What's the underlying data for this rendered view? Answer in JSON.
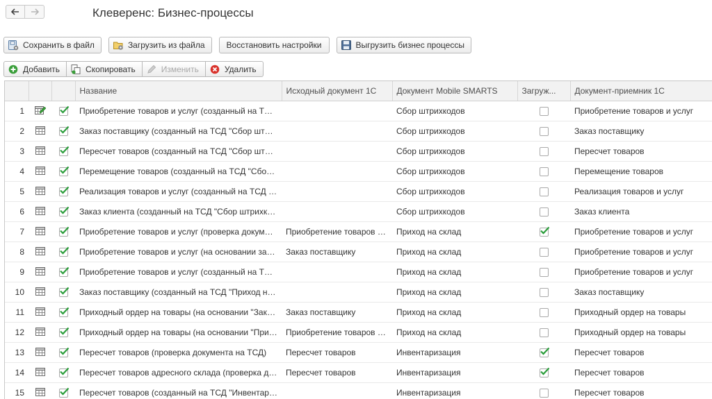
{
  "window": {
    "title": "Клеверенс: Бизнес-процессы"
  },
  "nav": {
    "back_icon": "arrow-left-icon",
    "forward_icon": "arrow-right-icon"
  },
  "toolbar1": {
    "save": "Сохранить в файл",
    "load": "Загрузить из файла",
    "restore": "Восстановить настройки",
    "export": "Выгрузить бизнес процессы"
  },
  "toolbar2": {
    "add": "Добавить",
    "copy": "Скопировать",
    "edit": "Изменить",
    "delete": "Удалить"
  },
  "colors": {
    "check_green": "#2a9d3a",
    "delete_red": "#d9322b",
    "add_green": "#3a9e3a"
  },
  "table": {
    "columns": [
      "",
      "",
      "",
      "Название",
      "Исходный документ 1С",
      "Документ Mobile SMARTS",
      "Загруж...",
      "Документ-приемник 1С"
    ],
    "rows": [
      {
        "n": "1",
        "icon": "edit-table-icon",
        "enabled": true,
        "name": "Приобретение товаров и услуг (созданный на ТСД \"Сбор штрихкодов\")",
        "src": "",
        "mobile": "Сбор штрихкодов",
        "loaded": false,
        "dest": "Приобретение товаров и услуг"
      },
      {
        "n": "2",
        "icon": "table-icon",
        "enabled": true,
        "name": "Заказ поставщику (созданный на ТСД \"Сбор штрихкодов\")",
        "src": "",
        "mobile": "Сбор штрихкодов",
        "loaded": false,
        "dest": "Заказ поставщику"
      },
      {
        "n": "3",
        "icon": "table-icon",
        "enabled": true,
        "name": "Пересчет товаров (созданный на ТСД \"Сбор штрихкодов\")",
        "src": "",
        "mobile": "Сбор штрихкодов",
        "loaded": false,
        "dest": "Пересчет товаров"
      },
      {
        "n": "4",
        "icon": "table-icon",
        "enabled": true,
        "name": "Перемещение товаров (созданный на ТСД \"Сбор штрихкодов\")",
        "src": "",
        "mobile": "Сбор штрихкодов",
        "loaded": false,
        "dest": "Перемещение товаров"
      },
      {
        "n": "5",
        "icon": "table-icon",
        "enabled": true,
        "name": "Реализация товаров и услуг (созданный на ТСД \"Сбор штрихкодов\")",
        "src": "",
        "mobile": "Сбор штрихкодов",
        "loaded": false,
        "dest": "Реализация товаров и услуг"
      },
      {
        "n": "6",
        "icon": "table-icon",
        "enabled": true,
        "name": "Заказ клиента (созданный на ТСД \"Сбор штрихкодов\")",
        "src": "",
        "mobile": "Сбор штрихкодов",
        "loaded": false,
        "dest": "Заказ клиента"
      },
      {
        "n": "7",
        "icon": "table-icon",
        "enabled": true,
        "name": "Приобретение товаров и услуг (проверка документа)",
        "src": "Приобретение товаров и услуг",
        "mobile": "Приход на склад",
        "loaded": true,
        "dest": "Приобретение товаров и услуг"
      },
      {
        "n": "8",
        "icon": "table-icon",
        "enabled": true,
        "name": "Приобретение товаров и услуг (на основании заказа)",
        "src": "Заказ поставщику",
        "mobile": "Приход на склад",
        "loaded": false,
        "dest": "Приобретение товаров и услуг"
      },
      {
        "n": "9",
        "icon": "table-icon",
        "enabled": true,
        "name": "Приобретение товаров и услуг (созданный на ТСД \"Приход на склад\")",
        "src": "",
        "mobile": "Приход на склад",
        "loaded": false,
        "dest": "Приобретение товаров и услуг"
      },
      {
        "n": "10",
        "icon": "table-icon",
        "enabled": true,
        "name": "Заказ поставщику (созданный на ТСД \"Приход на склад\")",
        "src": "",
        "mobile": "Приход на склад",
        "loaded": false,
        "dest": "Заказ поставщику"
      },
      {
        "n": "11",
        "icon": "table-icon",
        "enabled": true,
        "name": "Приходный ордер на товары (на основании \"Заказ поставщику\")",
        "src": "Заказ поставщику",
        "mobile": "Приход на склад",
        "loaded": false,
        "dest": "Приходный ордер на товары"
      },
      {
        "n": "12",
        "icon": "table-icon",
        "enabled": true,
        "name": "Приходный ордер на товары (на основании \"Приобретение товаров\")",
        "src": "Приобретение товаров и услуг",
        "mobile": "Приход на склад",
        "loaded": false,
        "dest": "Приходный ордер на товары"
      },
      {
        "n": "13",
        "icon": "table-icon",
        "enabled": true,
        "name": "Пересчет товаров (проверка документа на ТСД)",
        "src": "Пересчет товаров",
        "mobile": "Инвентаризация",
        "loaded": true,
        "dest": "Пересчет товаров"
      },
      {
        "n": "14",
        "icon": "table-icon",
        "enabled": true,
        "name": "Пересчет товаров адресного склада (проверка документа)",
        "src": "Пересчет товаров",
        "mobile": "Инвентаризация",
        "loaded": true,
        "dest": "Пересчет товаров"
      },
      {
        "n": "15",
        "icon": "table-icon",
        "enabled": true,
        "name": "Пересчет товаров (созданный на ТСД \"Инвентаризация\")",
        "src": "",
        "mobile": "Инвентаризация",
        "loaded": false,
        "dest": "Пересчет товаров"
      }
    ]
  }
}
